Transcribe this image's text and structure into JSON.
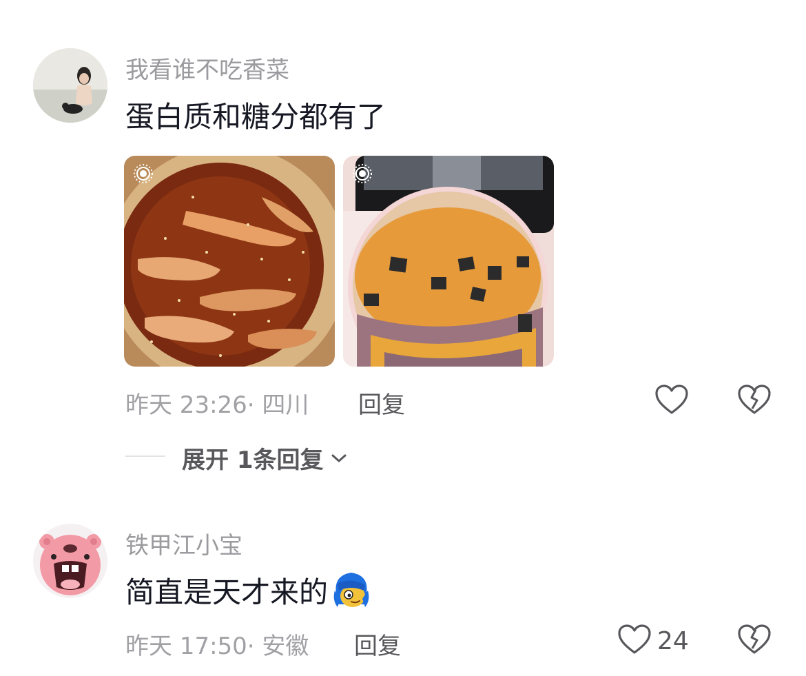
{
  "comments": [
    {
      "username": "我看谁不吃香菜",
      "text": "蛋白质和糖分都有了",
      "time": "昨天 23:26",
      "location": "· 四川",
      "reply_label": "回复",
      "like_count": "",
      "expand_label": "展开 1条回复",
      "photos": [
        "spicy-dish-photo",
        "dessert-cake-photo"
      ]
    },
    {
      "username": "铁甲江小宝",
      "text": "简直是天才来的",
      "time": "昨天 17:50",
      "location": "· 安徽",
      "reply_label": "回复",
      "like_count": "24"
    }
  ],
  "icons": {
    "like": "heart-outline-icon",
    "dislike": "broken-heart-icon",
    "live_photo": "live-photo-icon",
    "expand": "chevron-down-icon"
  },
  "colors": {
    "text_primary": "#161823",
    "text_secondary": "#9b9b9f",
    "action": "#58585c"
  }
}
